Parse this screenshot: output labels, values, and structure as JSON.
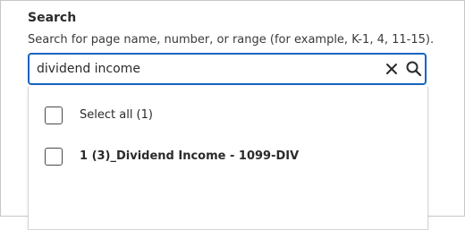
{
  "search": {
    "title": "Search",
    "help_text": "Search for page name, number, or range (for example, K-1, 4, 11-15).",
    "value": "dividend income",
    "clear_icon": "close-icon",
    "search_icon": "search-icon",
    "accent_color": "#1565c0"
  },
  "results": {
    "items": [
      {
        "label": "Select all (1)",
        "checked": false,
        "bold": false
      },
      {
        "label": "1 (3)_Dividend Income - 1099-DIV",
        "checked": false,
        "bold": true
      }
    ]
  }
}
